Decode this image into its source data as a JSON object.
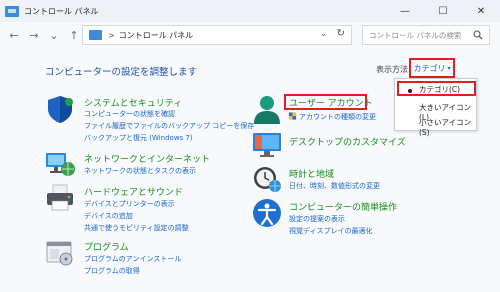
{
  "window": {
    "title": "コントロール パネル",
    "controls": {
      "minimize": "—",
      "maximize": "☐",
      "close": "✕"
    }
  },
  "nav": {
    "back": "←",
    "forward": "→",
    "recent": "⌄",
    "up": "↑",
    "breadcrumb_sep": ">",
    "breadcrumb": "コントロール パネル",
    "address_chevron": "⌄",
    "refresh": "↻",
    "search_placeholder": "コントロール パネルの検索"
  },
  "page": {
    "title": "コンピューターの設定を調整します",
    "view_by_label": "表示方法:",
    "view_by_value": "カテゴリ",
    "view_by_caret": "▾"
  },
  "view_menu": {
    "options": [
      "カテゴリ(C)",
      "大きいアイコン(L)",
      "小さいアイコン(S)"
    ],
    "selected_index": 0
  },
  "categories_left": [
    {
      "title": "システムとセキュリティ",
      "icon": "shield-icon",
      "links": [
        "コンピューターの状態を確認",
        "ファイル履歴でファイルのバックアップ コピーを保存",
        "バックアップと復元 (Windows 7)"
      ]
    },
    {
      "title": "ネットワークとインターネット",
      "icon": "network-icon",
      "links": [
        "ネットワークの状態とタスクの表示"
      ]
    },
    {
      "title": "ハードウェアとサウンド",
      "icon": "printer-icon",
      "links": [
        "デバイスとプリンターの表示",
        "デバイスの追加",
        "共通で使うモビリティ設定の調整"
      ]
    },
    {
      "title": "プログラム",
      "icon": "programs-icon",
      "links": [
        "プログラムのアンインストール",
        "プログラムの取得"
      ]
    }
  ],
  "categories_right": [
    {
      "title": "ユーザー アカウント",
      "icon": "user-icon",
      "links": [
        "アカウントの種類の変更"
      ]
    },
    {
      "title": "デスクトップのカスタマイズ",
      "icon": "monitor-icon",
      "links": []
    },
    {
      "title": "時計と地域",
      "icon": "clock-icon",
      "links": [
        "日付、時刻、数値形式の変更"
      ]
    },
    {
      "title": "コンピューターの簡単操作",
      "icon": "accessibility-icon",
      "links": [
        "設定の提案の表示",
        "視覚ディスプレイの最適化"
      ]
    }
  ],
  "colors": {
    "category_title": "#1a8a1a",
    "link": "#1c66c9",
    "highlight": "#e02020",
    "page_title": "#1c4fa8"
  }
}
